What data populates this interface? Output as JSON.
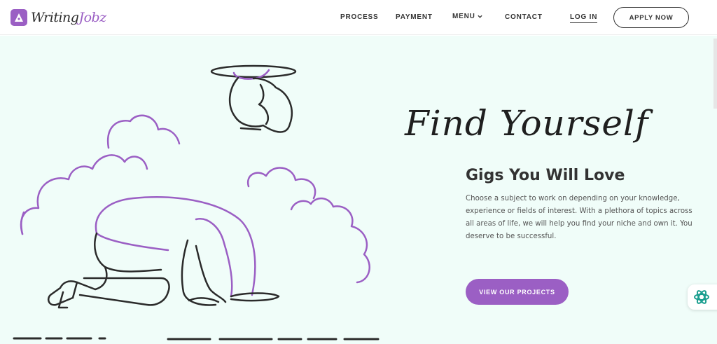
{
  "header": {
    "logo": {
      "word1": "Writing",
      "word2": "Jobz"
    },
    "nav": {
      "process": "PROCESS",
      "payment": "PAYMENT",
      "menu": "MENU",
      "contact": "CONTACT",
      "login": "LOG IN",
      "apply": "APPLY NOW"
    }
  },
  "hero": {
    "title": "Find Yourself",
    "subtitle": "Gigs You Will Love",
    "description": "Choose a subject to work on depending on your knowledge, experience or fields of interest. With a plethora of topics across all areas of life, we will help you find your niche and own it. You deserve to be successful.",
    "cta": "VIEW OUR PROJECTS"
  },
  "icons": {
    "logo": "pen-nib-icon",
    "menu_chevron": "chevron-down-icon",
    "widget": "sparkle-icon"
  },
  "colors": {
    "accent": "#9b5fc4",
    "hero_bg": "#f0fdf9",
    "line": "#2b2b2b"
  }
}
